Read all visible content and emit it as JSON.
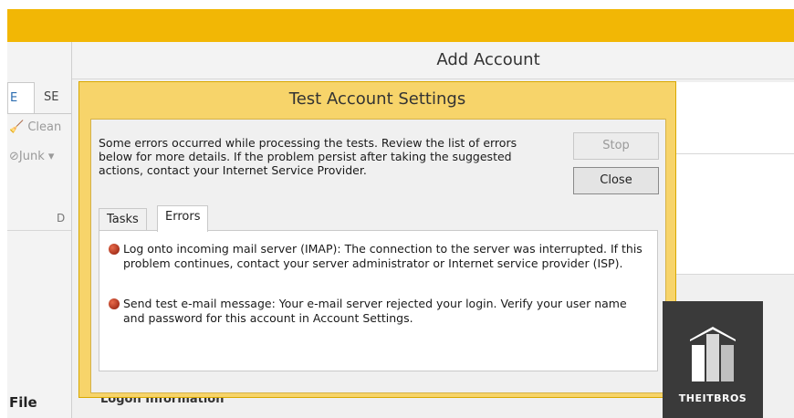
{
  "outlook": {
    "tabs": [
      {
        "label": "E"
      },
      {
        "label": "SE"
      }
    ],
    "ribbon": {
      "clean_label": "Clean",
      "junk_label": "Junk",
      "group_label": "D"
    },
    "file_label": "File"
  },
  "add_account": {
    "title": "Add Account",
    "logon_info": "Logon Information"
  },
  "dialog": {
    "title": "Test Account Settings",
    "message": "Some errors occurred while processing the tests. Review the list of errors below for more details. If the problem persist after taking the suggested actions, contact your Internet Service Provider.",
    "stop_label": "Stop",
    "close_label": "Close",
    "tabs": [
      {
        "label": "Tasks"
      },
      {
        "label": "Errors"
      }
    ],
    "errors": [
      {
        "text": "Log onto incoming mail server (IMAP): The connection to the server was interrupted. If this problem continues, contact your server administrator or Internet service provider (ISP)."
      },
      {
        "text": "Send test e-mail message: Your e-mail server rejected your login. Verify your user name and password for this account in Account Settings."
      }
    ]
  },
  "watermark": {
    "text": "THEITBROS"
  },
  "colors": {
    "accent": "#f2b705",
    "dialog_frame": "#f7d46a",
    "error_icon": "#b22a10"
  }
}
